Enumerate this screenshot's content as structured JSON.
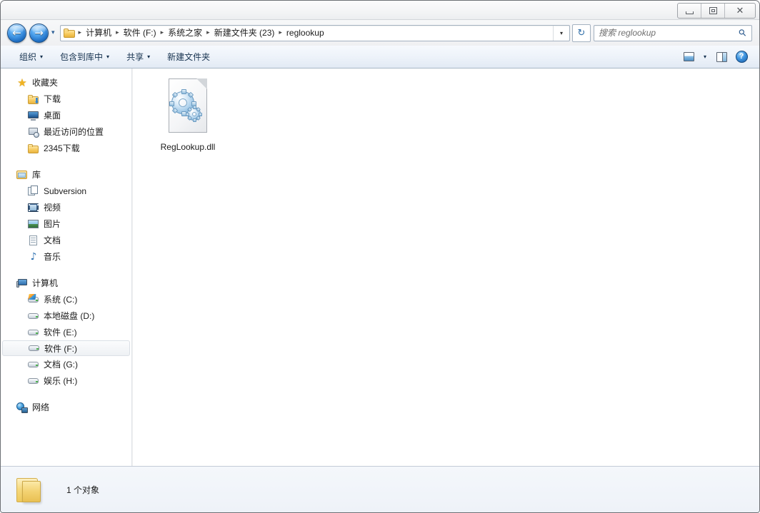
{
  "window": {
    "controls": {
      "minimize_label": "最小化",
      "maximize_label": "还原",
      "close_label": "关闭",
      "close_glyph": "✕"
    }
  },
  "addressbar": {
    "back_glyph": "←",
    "forward_glyph": "→",
    "history_glyph": "▾",
    "dropdown_glyph": "▾",
    "refresh_glyph": "↻",
    "separator": "▸",
    "crumbs": [
      "计算机",
      "软件 (F:)",
      "系统之家",
      "新建文件夹 (23)",
      "reglookup"
    ]
  },
  "search": {
    "placeholder": "搜索 reglookup",
    "value": "",
    "icon_glyph": "⚲"
  },
  "toolbar": {
    "items": [
      {
        "label": "组织",
        "caret": "▾",
        "has_caret": true
      },
      {
        "label": "包含到库中",
        "caret": "▾",
        "has_caret": true
      },
      {
        "label": "共享",
        "caret": "▾",
        "has_caret": true
      },
      {
        "label": "新建文件夹",
        "caret": "",
        "has_caret": false
      }
    ],
    "view_caret": "▾",
    "help_label": "?"
  },
  "sidebar": {
    "groups": [
      {
        "root": {
          "label": "收藏夹",
          "icon": "star-icon"
        },
        "items": [
          {
            "label": "下载",
            "icon": "download-folder-icon"
          },
          {
            "label": "桌面",
            "icon": "desktop-icon"
          },
          {
            "label": "最近访问的位置",
            "icon": "recent-places-icon"
          },
          {
            "label": "2345下载",
            "icon": "folder-icon"
          }
        ]
      },
      {
        "root": {
          "label": "库",
          "icon": "library-icon"
        },
        "items": [
          {
            "label": "Subversion",
            "icon": "subversion-icon"
          },
          {
            "label": "视频",
            "icon": "video-icon"
          },
          {
            "label": "图片",
            "icon": "picture-icon"
          },
          {
            "label": "文档",
            "icon": "document-icon"
          },
          {
            "label": "音乐",
            "icon": "music-icon"
          }
        ]
      },
      {
        "root": {
          "label": "计算机",
          "icon": "computer-icon"
        },
        "items": [
          {
            "label": "系统 (C:)",
            "icon": "system-drive-icon",
            "selected": false
          },
          {
            "label": "本地磁盘 (D:)",
            "icon": "drive-icon",
            "selected": false
          },
          {
            "label": "软件 (E:)",
            "icon": "drive-icon",
            "selected": false
          },
          {
            "label": "软件 (F:)",
            "icon": "drive-icon",
            "selected": true
          },
          {
            "label": "文档 (G:)",
            "icon": "drive-icon",
            "selected": false
          },
          {
            "label": "娱乐 (H:)",
            "icon": "drive-icon",
            "selected": false
          }
        ]
      },
      {
        "root": {
          "label": "网络",
          "icon": "network-icon"
        },
        "items": []
      }
    ]
  },
  "content": {
    "files": [
      {
        "name": "RegLookup.dll",
        "icon": "dll-gears-icon"
      }
    ]
  },
  "statusbar": {
    "text": "1 个对象",
    "icon": "folder-icon"
  },
  "colors": {
    "accent": "#2f6ea8",
    "toolbar_bg": "#eef3fa",
    "folder_yellow": "#f5c758",
    "selection": "#eef1f4"
  }
}
